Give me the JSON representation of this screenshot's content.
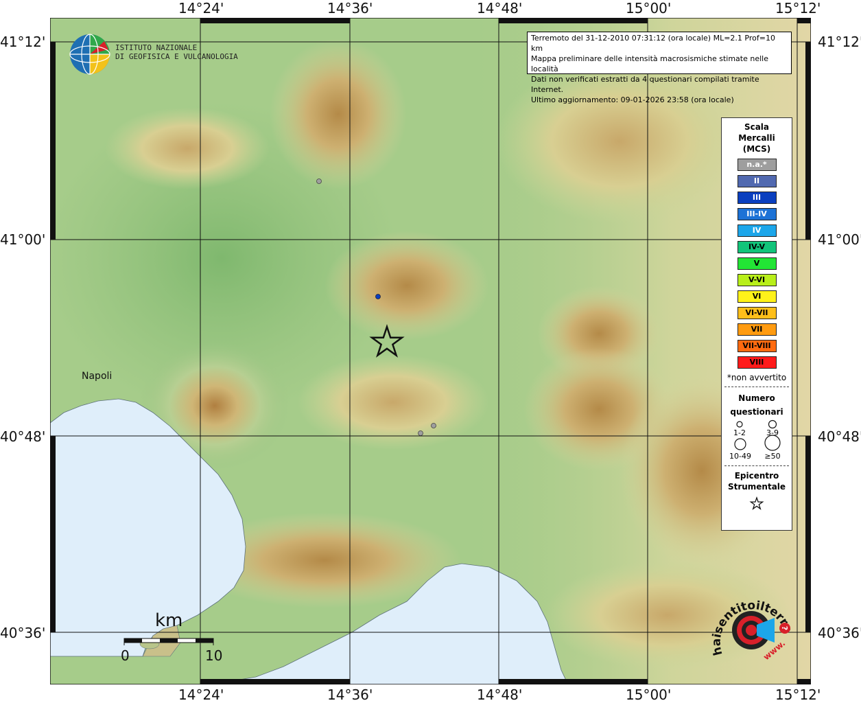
{
  "axis": {
    "top": [
      "14°24'",
      "14°36'",
      "14°48'",
      "15°00'",
      "15°12'"
    ],
    "bottom": [
      "14°24'",
      "14°36'",
      "14°48'",
      "15°00'",
      "15°12'"
    ],
    "left": [
      "41°12'",
      "41°00'",
      "40°48'",
      "40°36'"
    ],
    "right": [
      "41°12'",
      "41°00'",
      "40°48'",
      "40°36'"
    ]
  },
  "info": {
    "line1": "Terremoto del 31-12-2010 07:31:12 (ora locale) ML=2.1 Prof=10 km",
    "line2": "Mappa preliminare delle intensità macrosismiche stimate nelle località",
    "line3": "Dati non verificati estratti da 4 questionari compilati tramite Internet.",
    "line4": "Ultimo aggiornamento: 09-01-2026 23:58 (ora locale)"
  },
  "institute": {
    "line1": "ISTITUTO NAZIONALE",
    "line2": "DI GEOFISICA E VULCANOLOGIA"
  },
  "legend": {
    "title1": "Scala",
    "title2": "Mercalli",
    "title3": "(MCS)",
    "scale": [
      {
        "label": "n.a.*",
        "color": "#9e9e9e",
        "text": "#ffffff"
      },
      {
        "label": "II",
        "color": "#5169b0",
        "text": "#ffffff"
      },
      {
        "label": "III",
        "color": "#0a3fbf",
        "text": "#ffffff"
      },
      {
        "label": "III-IV",
        "color": "#1c72d6",
        "text": "#ffffff"
      },
      {
        "label": "IV",
        "color": "#1ca6ea",
        "text": "#ffffff"
      },
      {
        "label": "IV-V",
        "color": "#12c47a",
        "text": "#000000"
      },
      {
        "label": "V",
        "color": "#22e535",
        "text": "#000000"
      },
      {
        "label": "V-VI",
        "color": "#b8ef1a",
        "text": "#000000"
      },
      {
        "label": "VI",
        "color": "#fff21a",
        "text": "#000000"
      },
      {
        "label": "VI-VII",
        "color": "#ffbf1a",
        "text": "#000000"
      },
      {
        "label": "VII",
        "color": "#ff9b10",
        "text": "#000000"
      },
      {
        "label": "VII-VIII",
        "color": "#ff6a10",
        "text": "#000000"
      },
      {
        "label": "VIII",
        "color": "#ff1a1a",
        "text": "#000000"
      }
    ],
    "non_felt_note": "*non avvertito",
    "questionnaires_title1": "Numero",
    "questionnaires_title2": "questionari",
    "sizes": [
      "1-2",
      "3-9",
      "10-49",
      "≥50"
    ],
    "epicenter_title1": "Epicentro",
    "epicenter_title2": "Strumentale"
  },
  "places": {
    "napoli": "Napoli"
  },
  "scale_bar": {
    "unit": "km",
    "start": "0",
    "end": "10"
  },
  "site_logo": {
    "name": "haisentitoilterremoto.it",
    "prefix": "www."
  }
}
